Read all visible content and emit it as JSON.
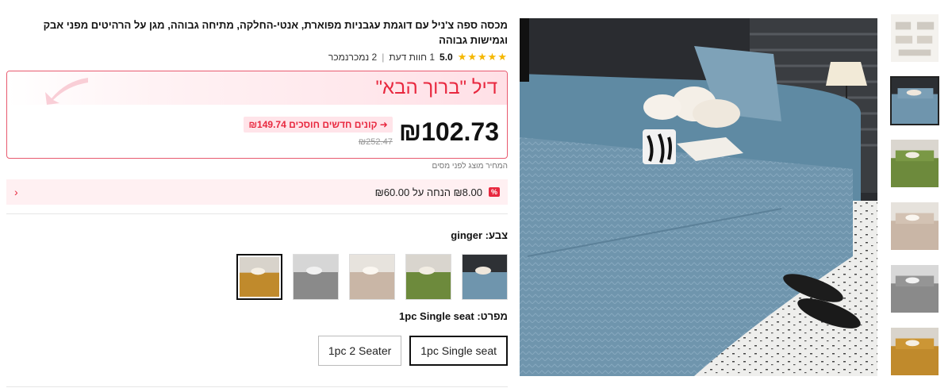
{
  "product": {
    "title": "מכסה ספה צ'ניל עם דוגמת עגבניות מפוארת, אנטי-החלקה, מתיחה גבוהה, מגן על הרהיטים מפני אבק וגמישות גבוהה",
    "rating_stars": "★★★★★",
    "rating_value": "5.0",
    "reviews": "1 חוות דעת",
    "sold": "2 נמכרנמכר"
  },
  "deal": {
    "title": "דיל \"ברוך הבא\"",
    "price": "₪102.73",
    "savings": "קונים חדשים חוסכים ₪149.74",
    "original_price": "₪252.47",
    "tax_note": "המחיר מוצג לפני מסים"
  },
  "coupon": {
    "tag": "%",
    "text": "₪8.00 הנחה על ₪60.00",
    "chevron": "‹"
  },
  "color": {
    "label": "צבע: ginger",
    "options": [
      "blue",
      "green",
      "beige",
      "gray",
      "ginger"
    ],
    "selected": "ginger"
  },
  "size": {
    "label": "מפרט: 1pc Single seat",
    "options": [
      "1pc Single seat",
      "1pc 2 Seater"
    ],
    "selected": "1pc Single seat"
  },
  "colors": {
    "accent": "#e8283f",
    "star": "#f5b700",
    "sofa_blue": "#6f95ad"
  }
}
